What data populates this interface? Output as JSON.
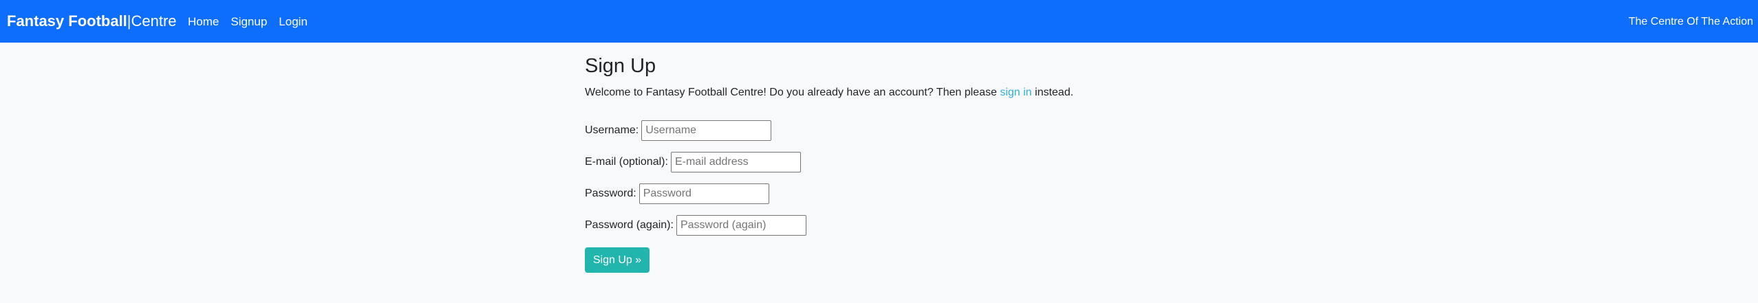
{
  "navbar": {
    "brand_bold": "Fantasy Football",
    "brand_rest": "|Centre",
    "links": [
      "Home",
      "Signup",
      "Login"
    ],
    "tagline": "The Centre Of The Action"
  },
  "colors": {
    "navbar_bg": "#0d6efd",
    "page_bg": "#f8f9fa",
    "accent": "#22b5ad",
    "link": "#31b0d5"
  },
  "main": {
    "title": "Sign Up",
    "intro_before": "Welcome to Fantasy Football Centre! Do you already have an account? Then please ",
    "intro_link": "sign in",
    "intro_after": " instead.",
    "form": {
      "username_label": "Username:",
      "username_placeholder": "Username",
      "email_label": "E-mail (optional):",
      "email_placeholder": "E-mail address",
      "password_label": "Password:",
      "password_placeholder": "Password",
      "password2_label": "Password (again):",
      "password2_placeholder": "Password (again)",
      "submit_label": "Sign Up »"
    }
  }
}
